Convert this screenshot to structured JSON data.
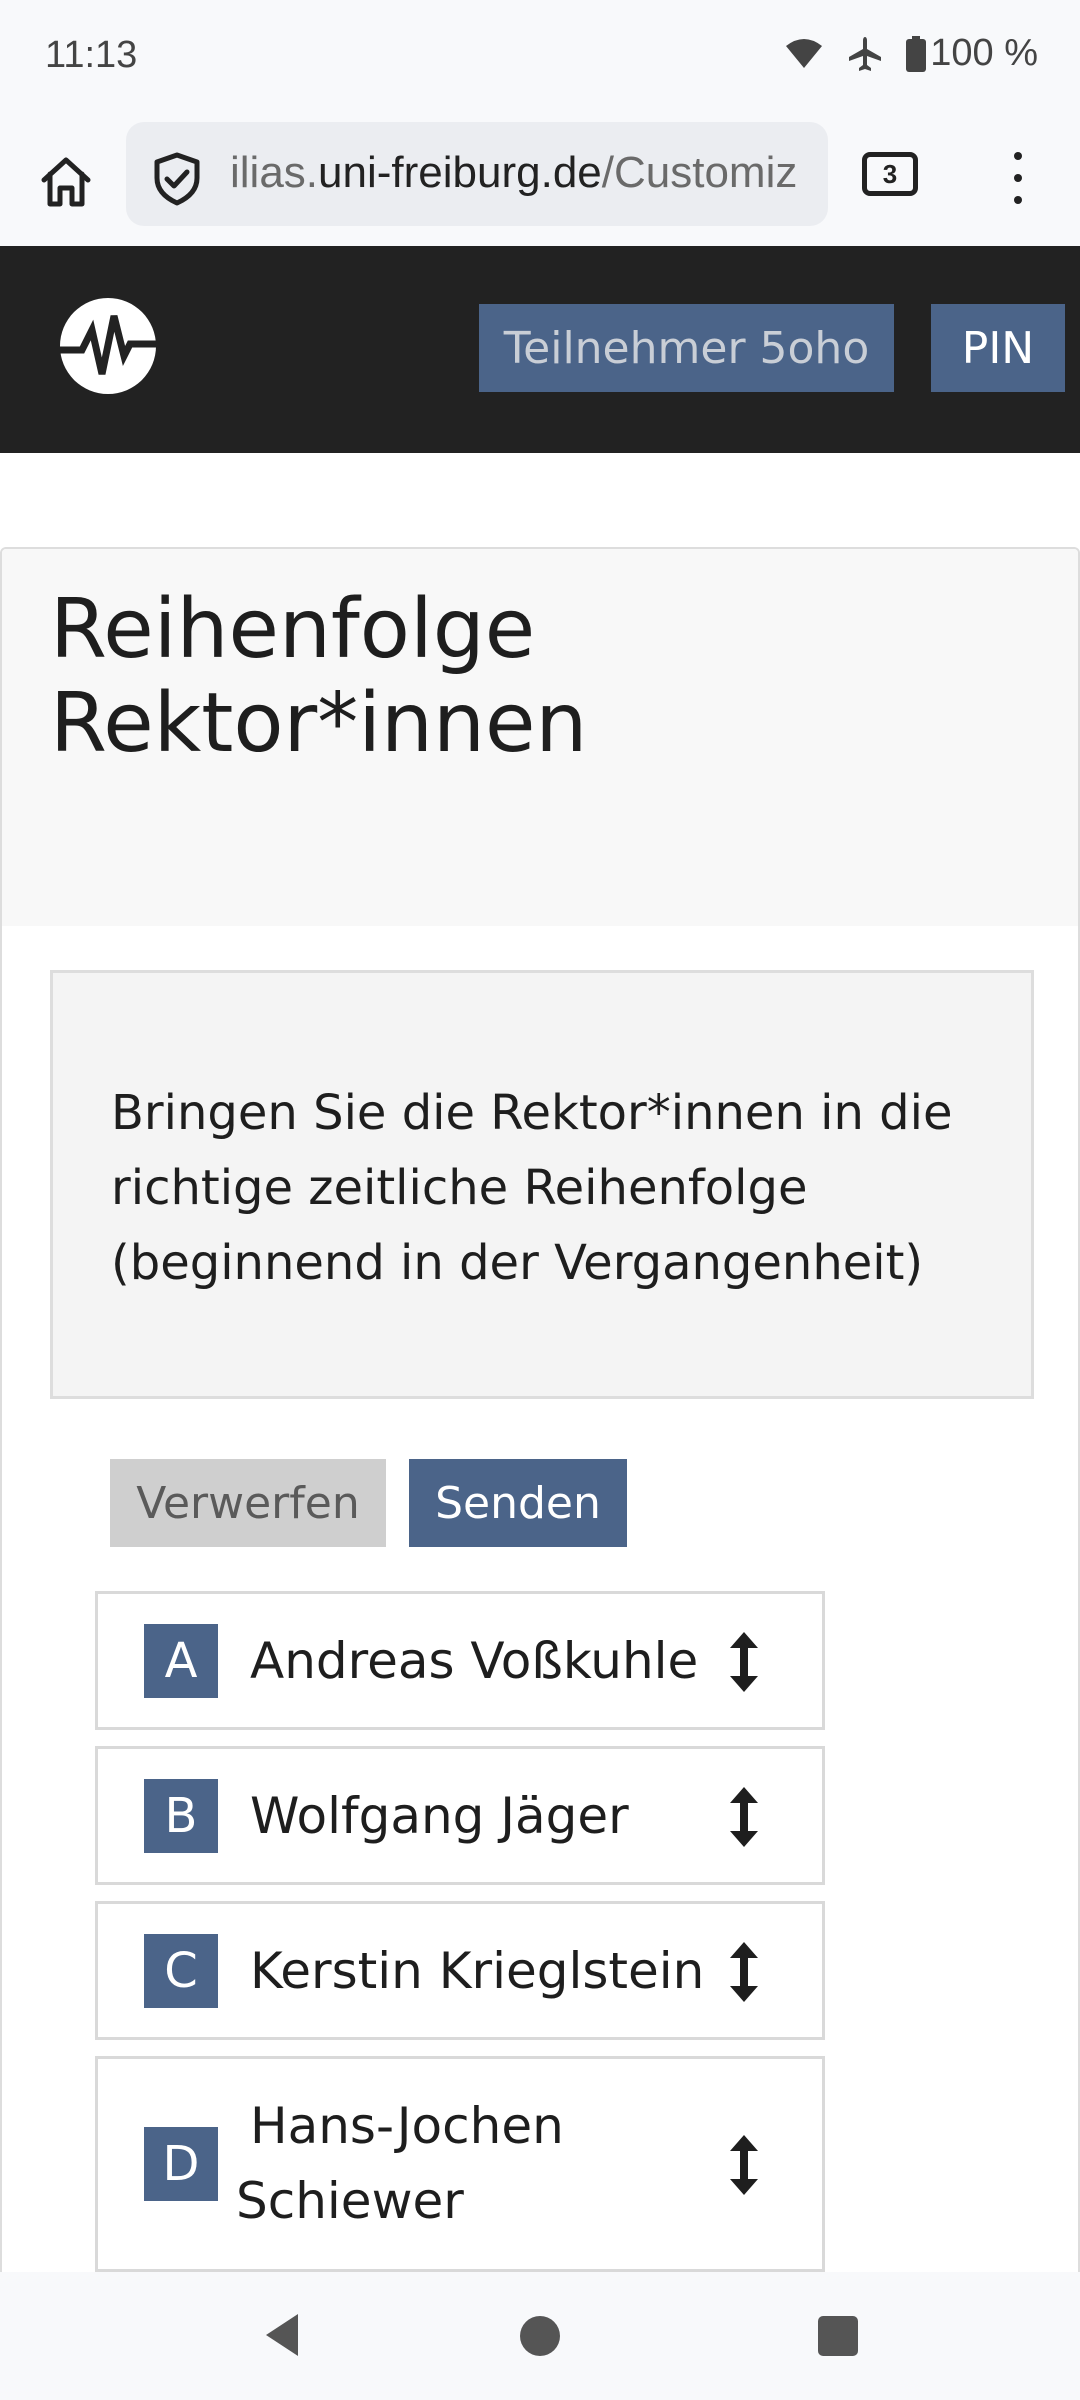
{
  "status_bar": {
    "time": "11:13",
    "battery": "100 %",
    "icons": [
      "wifi-icon",
      "airplane-icon",
      "battery-icon"
    ]
  },
  "browser": {
    "url_host": "ilias.uni-freiburg.de",
    "url_path": "/Customiz",
    "url_sub": "ilias.",
    "tab_count": "3"
  },
  "header": {
    "user_label": "Teilnehmer 5oho",
    "pin_label": "PIN"
  },
  "question": {
    "title_line1": "Reihenfolge",
    "title_line2": "Rektor*innen",
    "instruction": "Bringen Sie die Rektor*innen in die richtige zeitliche Reihenfolge (beginnend in der Vergangenheit)",
    "discard_label": "Verwerfen",
    "send_label": "Senden",
    "items": [
      {
        "letter": "A",
        "name": "Andreas Voßkuhle"
      },
      {
        "letter": "B",
        "name": "Wolfgang Jäger"
      },
      {
        "letter": "C",
        "name": "Kerstin Krieglstein"
      },
      {
        "letter": "D",
        "name_line1": "Hans-Jochen",
        "name_line2": "Schiewer"
      }
    ]
  },
  "colors": {
    "header_bg": "#222222",
    "accent": "#4b6489",
    "discard_bg": "#cfcfcf"
  }
}
